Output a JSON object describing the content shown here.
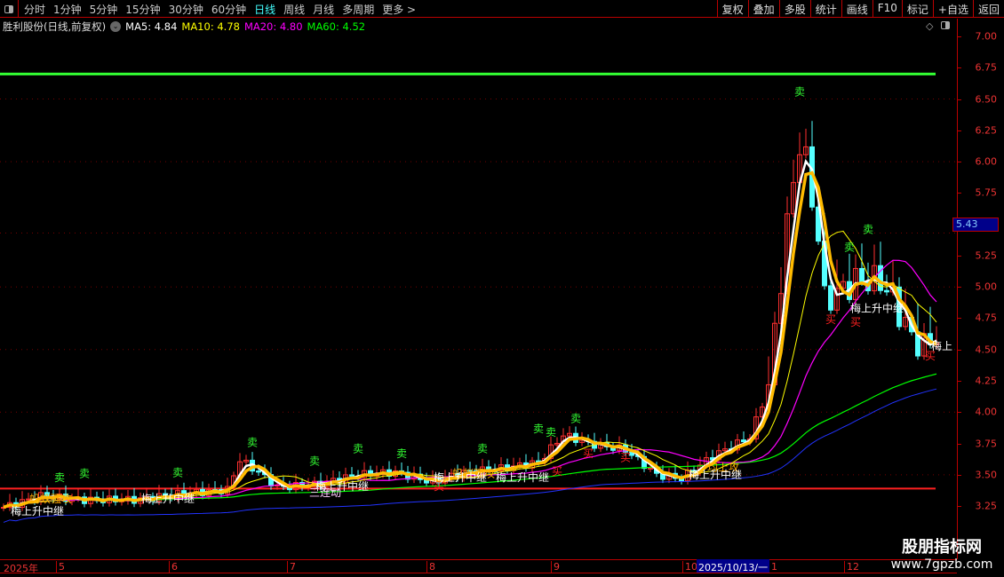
{
  "toolbar": {
    "periods": [
      "分时",
      "1分钟",
      "5分钟",
      "15分钟",
      "30分钟",
      "60分钟",
      "日线",
      "周线",
      "月线",
      "多周期",
      "更多 >"
    ],
    "active_period": "日线",
    "right_buttons": [
      "复权",
      "叠加",
      "多股",
      "统计",
      "画线",
      "F10",
      "标记",
      "+自选",
      "返回"
    ]
  },
  "info": {
    "title": "胜利股份(日线,前复权)",
    "ma5": "MA5: 4.84",
    "ma10": "MA10: 4.78",
    "ma20": "MA20: 4.80",
    "ma60": "MA60: 4.52"
  },
  "colors": {
    "ma5": "#ffffff",
    "ma10": "#ffff00",
    "ma20": "#ff00ff",
    "ma60": "#00ff00",
    "up": "#ff3030",
    "down": "#55ffff",
    "thick": "#ffbb00"
  },
  "price_axis": {
    "ticks": [
      "7.00",
      "6.75",
      "6.50",
      "6.25",
      "6.00",
      "5.75",
      "5.50",
      "5.25",
      "5.00",
      "4.75",
      "4.50",
      "4.25",
      "4.00",
      "3.75",
      "3.50",
      "3.25"
    ],
    "current": "5.43"
  },
  "dates": {
    "labels": [
      "2025年",
      "5",
      "6",
      "7",
      "8",
      "9",
      "10",
      "1",
      "12"
    ],
    "cursor": "2025/10/13/一"
  },
  "watermark": {
    "name": "股朋指标网",
    "url": "www.7gpzb.com"
  },
  "chart_data": {
    "type": "candlestick",
    "ylim": [
      3.1,
      7.1
    ],
    "resistance": 6.7,
    "support": 3.39,
    "price_path": [
      [
        0,
        3.24
      ],
      [
        6,
        3.33
      ],
      [
        13,
        3.3
      ],
      [
        21,
        3.3
      ],
      [
        29,
        3.35
      ],
      [
        36,
        3.38
      ],
      [
        38,
        3.62
      ],
      [
        41,
        3.52
      ],
      [
        44,
        3.4
      ],
      [
        50,
        3.42
      ],
      [
        57,
        3.5
      ],
      [
        63,
        3.52
      ],
      [
        69,
        3.44
      ],
      [
        74,
        3.52
      ],
      [
        80,
        3.55
      ],
      [
        86,
        3.6
      ],
      [
        90,
        3.82
      ],
      [
        94,
        3.75
      ],
      [
        100,
        3.7
      ],
      [
        105,
        3.5
      ],
      [
        109,
        3.47
      ],
      [
        114,
        3.65
      ],
      [
        120,
        3.8
      ],
      [
        123,
        4.2
      ],
      [
        126,
        5.5
      ],
      [
        128,
        6.15
      ],
      [
        129,
        6.0
      ],
      [
        131,
        5.4
      ],
      [
        132,
        4.9
      ],
      [
        134,
        4.95
      ],
      [
        137,
        5.05
      ],
      [
        141,
        5.05
      ],
      [
        143,
        4.9
      ],
      [
        146,
        4.6
      ],
      [
        148,
        4.52
      ],
      [
        150,
        4.62
      ]
    ],
    "signals": [
      {
        "bar": 9,
        "price": 3.45,
        "text": "卖",
        "color": "#33ff33"
      },
      {
        "bar": 13,
        "price": 3.48,
        "text": "卖",
        "color": "#33ff33"
      },
      {
        "bar": 28,
        "price": 3.49,
        "text": "卖",
        "color": "#33ff33"
      },
      {
        "bar": 40,
        "price": 3.73,
        "text": "卖",
        "color": "#33ff33"
      },
      {
        "bar": 50,
        "price": 3.58,
        "text": "卖",
        "color": "#33ff33"
      },
      {
        "bar": 57,
        "price": 3.68,
        "text": "卖",
        "color": "#33ff33"
      },
      {
        "bar": 64,
        "price": 3.64,
        "text": "卖",
        "color": "#33ff33"
      },
      {
        "bar": 77,
        "price": 3.68,
        "text": "卖",
        "color": "#33ff33"
      },
      {
        "bar": 86,
        "price": 3.84,
        "text": "卖",
        "color": "#33ff33"
      },
      {
        "bar": 88,
        "price": 3.81,
        "text": "卖",
        "color": "#33ff33"
      },
      {
        "bar": 92,
        "price": 3.92,
        "text": "卖",
        "color": "#33ff33"
      },
      {
        "bar": 128,
        "price": 6.53,
        "text": "卖",
        "color": "#33ff33"
      },
      {
        "bar": 136,
        "price": 5.29,
        "text": "卖",
        "color": "#33ff33"
      },
      {
        "bar": 139,
        "price": 5.43,
        "text": "卖",
        "color": "#33ff33"
      },
      {
        "bar": 70,
        "price": 3.38,
        "text": "买",
        "color": "#ff2020"
      },
      {
        "bar": 89,
        "price": 3.5,
        "text": "买",
        "color": "#ff2020"
      },
      {
        "bar": 94,
        "price": 3.64,
        "text": "买",
        "color": "#ff2020"
      },
      {
        "bar": 100,
        "price": 3.61,
        "text": "买",
        "color": "#ff2020"
      },
      {
        "bar": 133,
        "price": 4.71,
        "text": "买",
        "color": "#ff2020"
      },
      {
        "bar": 137,
        "price": 4.69,
        "text": "买",
        "color": "#ff2020"
      },
      {
        "bar": 149,
        "price": 4.42,
        "text": "买",
        "color": "#ff2020"
      },
      {
        "bar": 5,
        "price": 3.28,
        "text": "蚂蚁强攻",
        "color": "#ffaa00"
      },
      {
        "bar": 114,
        "price": 3.53,
        "text": "均上攻",
        "color": "#ffaa00"
      },
      {
        "bar": 73,
        "price": 3.48,
        "text": "蚂蚁强攻",
        "color": "#ffaa00"
      },
      {
        "bar": 2,
        "price": 3.18,
        "text": "梅上升中继",
        "color": "#ffffff"
      },
      {
        "bar": 23,
        "price": 3.28,
        "text": "梅上升中继",
        "color": "#ffffff"
      },
      {
        "bar": 51,
        "price": 3.38,
        "text": "梅上升中继",
        "color": "#ffffff"
      },
      {
        "bar": 50,
        "price": 3.33,
        "text": "三连动",
        "color": "#ffccff"
      },
      {
        "bar": 70,
        "price": 3.45,
        "text": "梅上升中继",
        "color": "#ffffff"
      },
      {
        "bar": 80,
        "price": 3.45,
        "text": "梅上升中继",
        "color": "#ffffff"
      },
      {
        "bar": 111,
        "price": 3.47,
        "text": "梅上升中继",
        "color": "#ffffff"
      },
      {
        "bar": 137,
        "price": 4.8,
        "text": "梅上升中继",
        "color": "#ffffff"
      },
      {
        "bar": 150,
        "price": 4.5,
        "text": "梅上",
        "color": "#ffffff"
      }
    ]
  }
}
